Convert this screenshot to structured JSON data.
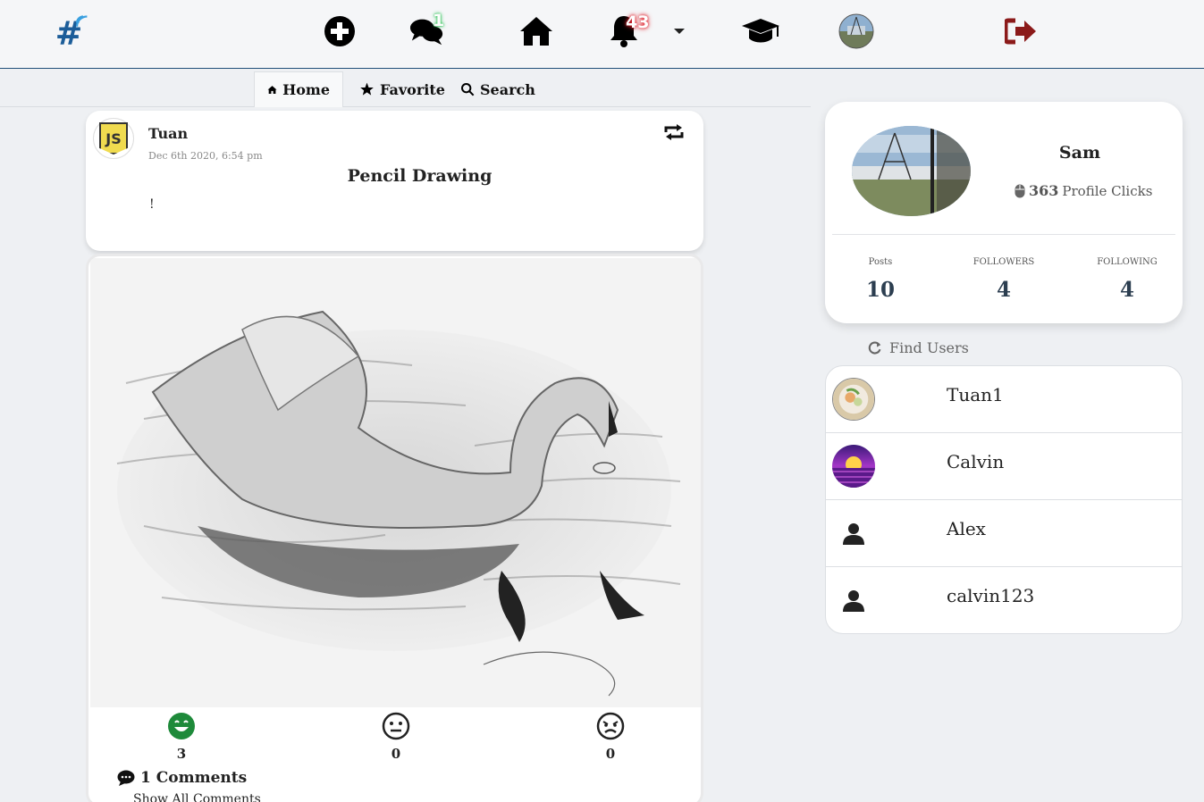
{
  "nav": {
    "messages_badge": "1",
    "notifications_badge": "43"
  },
  "tabs": [
    {
      "label": "Home",
      "icon": "home-icon",
      "active": true
    },
    {
      "label": "Favorite",
      "icon": "star-icon",
      "active": false
    },
    {
      "label": "Search",
      "icon": "search-icon",
      "active": false
    }
  ],
  "post": {
    "author": "Tuan",
    "date": "Dec 6th 2020, 6:54 pm",
    "title": "Pencil Drawing",
    "body": "!",
    "reactions": {
      "happy": "3",
      "neutral": "0",
      "angry": "0"
    },
    "comments_label": "1 Comments",
    "show_all_label": "Show All Comments"
  },
  "profile": {
    "name": "Sam",
    "clicks": "363",
    "clicks_label": "Profile Clicks",
    "stats": {
      "posts_label": "Posts",
      "posts": "10",
      "followers_label": "FOLLOWERS",
      "followers": "4",
      "following_label": "FOLLOWING",
      "following": "4"
    }
  },
  "find_users_label": "Find Users",
  "users": [
    "Tuan1",
    "Calvin",
    "Alex",
    "calvin123"
  ],
  "colors": {
    "accent": "#1f4e79",
    "logout": "#8b1a1a",
    "happy": "#1e8a3a"
  }
}
